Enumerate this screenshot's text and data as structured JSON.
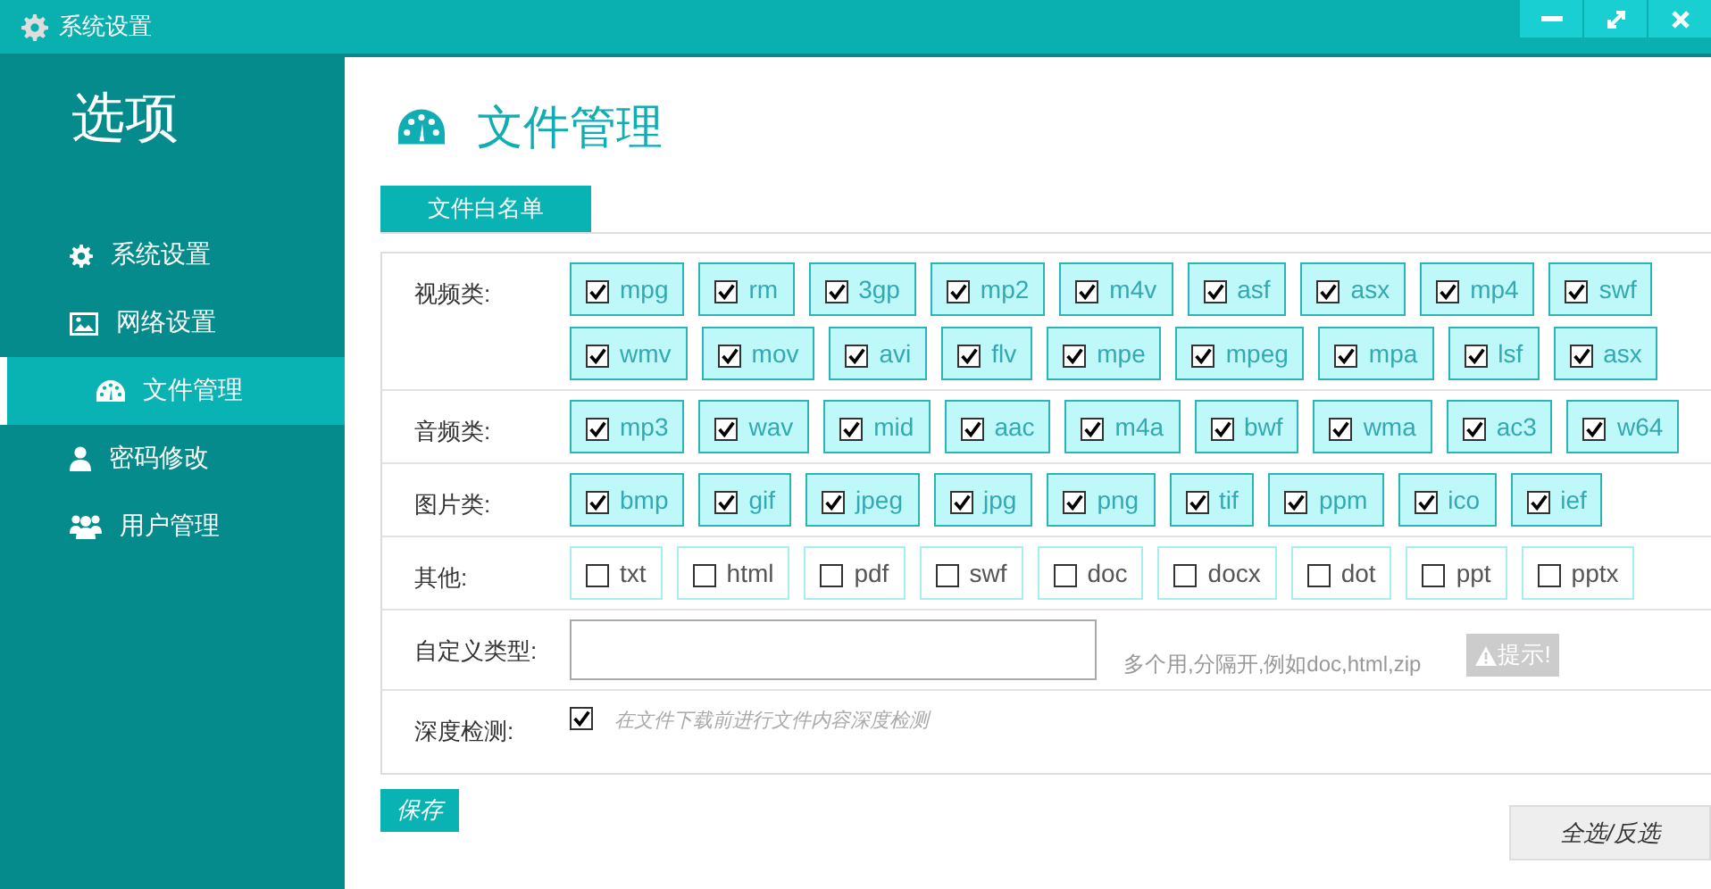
{
  "window": {
    "title": "系统设置"
  },
  "sidebar": {
    "heading": "选项",
    "items": [
      {
        "label": "系统设置",
        "selected": false
      },
      {
        "label": "网络设置",
        "selected": false,
        "children": [
          {
            "label": "文件管理",
            "selected": true
          }
        ]
      },
      {
        "label": "密码修改",
        "selected": false
      },
      {
        "label": "用户管理",
        "selected": false
      }
    ]
  },
  "page": {
    "title": "文件管理"
  },
  "tabs": [
    {
      "label": "文件白名单",
      "selected": true
    }
  ],
  "categories": [
    {
      "label": "视频类:",
      "items": [
        {
          "label": "mpg",
          "checked": true
        },
        {
          "label": "rm",
          "checked": true
        },
        {
          "label": "3gp",
          "checked": true
        },
        {
          "label": "mp2",
          "checked": true
        },
        {
          "label": "m4v",
          "checked": true
        },
        {
          "label": "asf",
          "checked": true
        },
        {
          "label": "asx",
          "checked": true
        },
        {
          "label": "mp4",
          "checked": true
        },
        {
          "label": "swf",
          "checked": true
        },
        {
          "label": "wmv",
          "checked": true
        },
        {
          "label": "mov",
          "checked": true
        },
        {
          "label": "avi",
          "checked": true
        },
        {
          "label": "flv",
          "checked": true
        },
        {
          "label": "mpe",
          "checked": true
        },
        {
          "label": "mpeg",
          "checked": true
        },
        {
          "label": "mpa",
          "checked": true
        },
        {
          "label": "lsf",
          "checked": true
        },
        {
          "label": "asx",
          "checked": true
        }
      ]
    },
    {
      "label": "音频类:",
      "items": [
        {
          "label": "mp3",
          "checked": true
        },
        {
          "label": "wav",
          "checked": true
        },
        {
          "label": "mid",
          "checked": true
        },
        {
          "label": "aac",
          "checked": true
        },
        {
          "label": "m4a",
          "checked": true
        },
        {
          "label": "bwf",
          "checked": true
        },
        {
          "label": "wma",
          "checked": true
        },
        {
          "label": "ac3",
          "checked": true
        },
        {
          "label": "w64",
          "checked": true
        }
      ]
    },
    {
      "label": "图片类:",
      "items": [
        {
          "label": "bmp",
          "checked": true
        },
        {
          "label": "gif",
          "checked": true
        },
        {
          "label": "jpeg",
          "checked": true
        },
        {
          "label": "jpg",
          "checked": true
        },
        {
          "label": "png",
          "checked": true
        },
        {
          "label": "tif",
          "checked": true
        },
        {
          "label": "ppm",
          "checked": true
        },
        {
          "label": "ico",
          "checked": true
        },
        {
          "label": "ief",
          "checked": true
        }
      ]
    },
    {
      "label": "其他:",
      "items": [
        {
          "label": "txt",
          "checked": false
        },
        {
          "label": "html",
          "checked": false
        },
        {
          "label": "pdf",
          "checked": false
        },
        {
          "label": "swf",
          "checked": false
        },
        {
          "label": "doc",
          "checked": false
        },
        {
          "label": "docx",
          "checked": false
        },
        {
          "label": "dot",
          "checked": false
        },
        {
          "label": "ppt",
          "checked": false
        },
        {
          "label": "pptx",
          "checked": false
        }
      ]
    }
  ],
  "custom_type": {
    "label": "自定义类型:",
    "help": "多个用,分隔开,例如doc,html,zip",
    "hint_button": "提示!"
  },
  "deep_check": {
    "label": "深度检测:",
    "checked": true,
    "description": "在文件下载前进行文件内容深度检测"
  },
  "buttons": {
    "save": "保存",
    "toggle_all": "全选/反选"
  }
}
